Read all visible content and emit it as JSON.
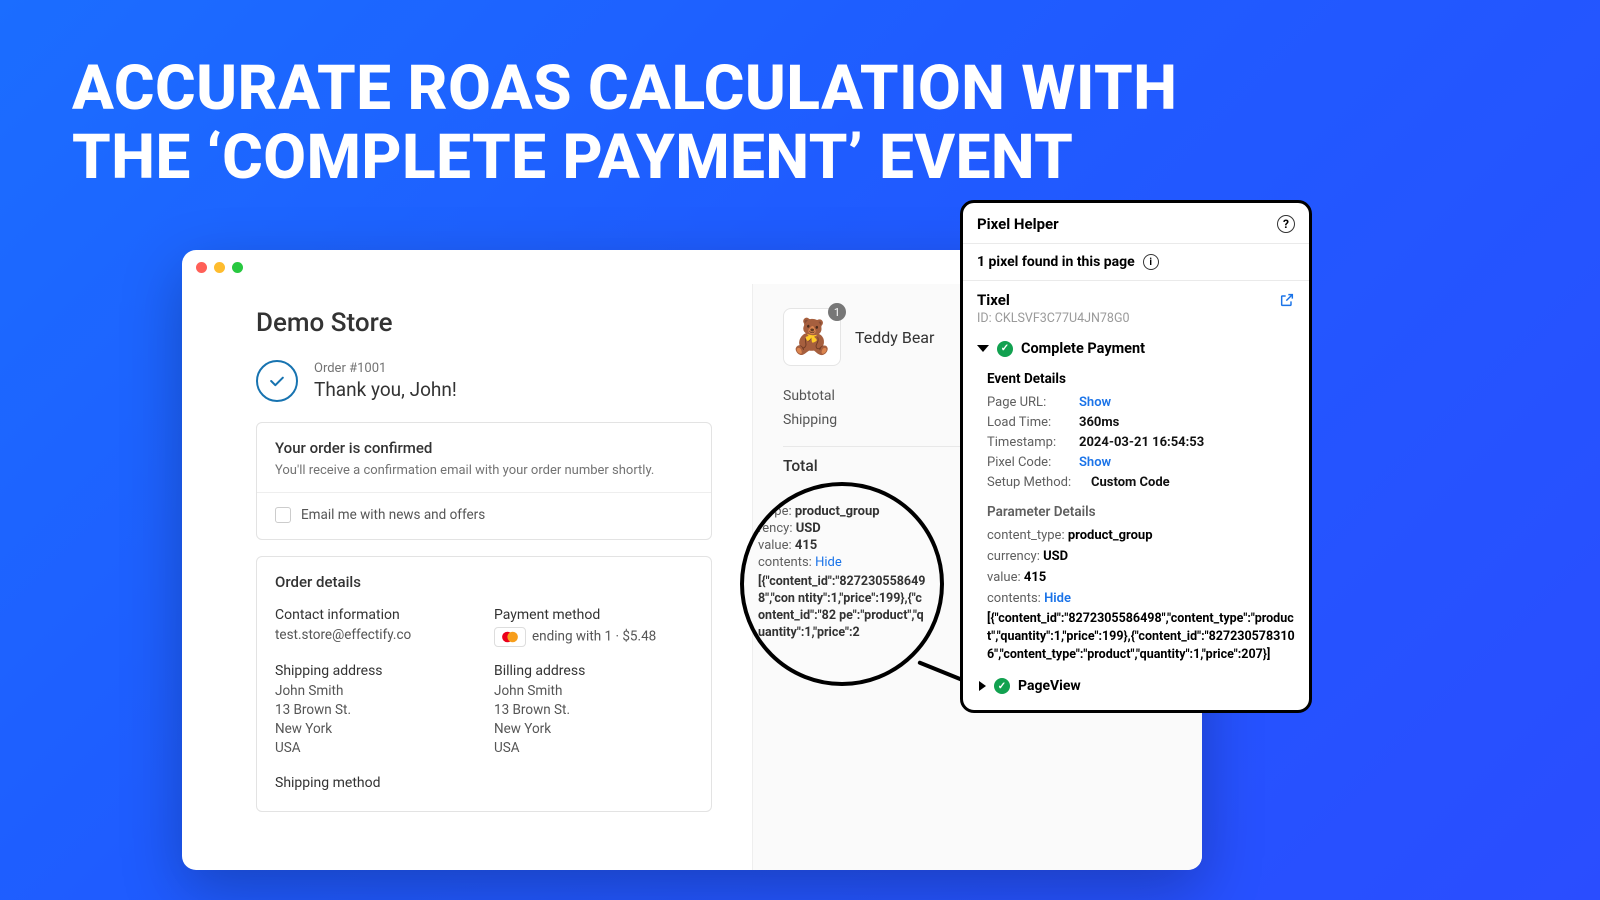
{
  "headline_line1": "ACCURATE ROAS CALCULATION WITH",
  "headline_line2": "THE ‘COMPLETE PAYMENT’ EVENT",
  "store": {
    "title": "Demo Store",
    "order_no": "Order #1001",
    "thank_you": "Thank you, John!",
    "confirm_title": "Your order is confirmed",
    "confirm_sub": "You'll receive a confirmation email with your order number shortly.",
    "news_label": "Email me with news and offers",
    "order_details_title": "Order details",
    "contact_label": "Contact information",
    "contact_email": "test.store@effectify.co",
    "payment_label": "Payment method",
    "payment_text": "ending with 1 · $5.48",
    "shipping_label": "Shipping address",
    "billing_label": "Billing address",
    "address": {
      "name": "John Smith",
      "street": "13 Brown St.",
      "city": "New York",
      "country": "USA"
    },
    "shipping_method_label": "Shipping method"
  },
  "cart": {
    "item_name": "Teddy Bear",
    "qty": "1",
    "subtotal_label": "Subtotal",
    "shipping_label": "Shipping",
    "total_label": "Total"
  },
  "magnifier": {
    "content_type_k": "_type:",
    "content_type_v": "product_group",
    "currency_k": "rency:",
    "currency_v": "USD",
    "value_k": "value:",
    "value_v": "415",
    "contents_k": "contents:",
    "contents_link": "Hide",
    "json": "[{\"content_id\":\"8272305586498\",\"content_type\":\"product\",\"quantity\":1,\"price\":199},{\"content_id\":\"8272305783106\",\"content_type\":\"product\",\"quantity\":1,\"price\":207}]",
    "json_display": "[{\"content_id\":\"8272305586498\",\"con\nntity\":1,\"price\":199},{\"content_id\":\"82\npe\":\"product\",\"quantity\":1,\"price\":2"
  },
  "pixel_helper": {
    "title": "Pixel Helper",
    "found": "1 pixel found in this page",
    "tixel": "Tixel",
    "id_label": "ID:",
    "id_value": "CKLSVF3C77U4JN78G0",
    "event_name": "Complete Payment",
    "event_details_title": "Event Details",
    "kv": {
      "page_url_k": "Page URL:",
      "page_url_v": "Show",
      "load_time_k": "Load Time:",
      "load_time_v": "360ms",
      "timestamp_k": "Timestamp:",
      "timestamp_v": "2024-03-21 16:54:53",
      "pixel_code_k": "Pixel Code:",
      "pixel_code_v": "Show",
      "setup_k": "Setup Method:",
      "setup_v": "Custom Code"
    },
    "param_title": "Parameter Details",
    "params": {
      "content_type_k": "content_type:",
      "content_type_v": "product_group",
      "currency_k": "currency:",
      "currency_v": "USD",
      "value_k": "value:",
      "value_v": "415",
      "contents_k": "contents:",
      "contents_link": "Hide"
    },
    "json": "[{\"content_id\":\"8272305586498\",\"content_type\":\"product\",\"quantity\":1,\"price\":199},{\"content_id\":\"8272305783106\",\"content_type\":\"product\",\"quantity\":1,\"price\":207}]",
    "pageview": "PageView"
  }
}
